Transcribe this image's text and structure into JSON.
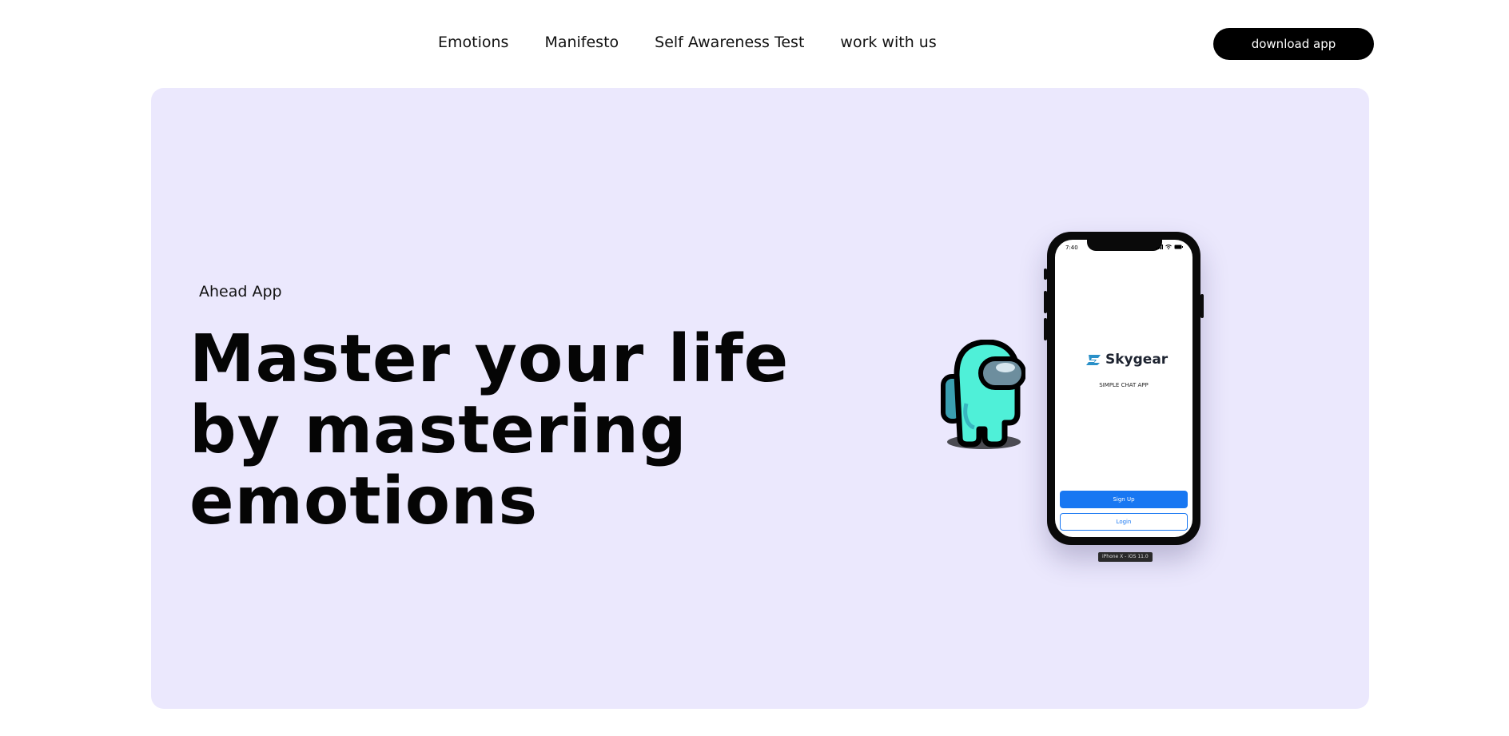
{
  "nav": {
    "items": [
      "Emotions",
      "Manifesto",
      "Self Awareness Test",
      "work with us"
    ],
    "download_label": "download app"
  },
  "hero": {
    "eyebrow": "Ahead App",
    "headline": "Master your life by mastering emotions",
    "background_color": "#ebe8fd"
  },
  "phone": {
    "time": "7:40",
    "brand": "Skygear",
    "subtitle": "SIMPLE CHAT APP",
    "signup_label": "Sign Up",
    "login_label": "Login",
    "device_label": "iPhone X - iOS 11.0",
    "accent_color": "#1877f2"
  }
}
